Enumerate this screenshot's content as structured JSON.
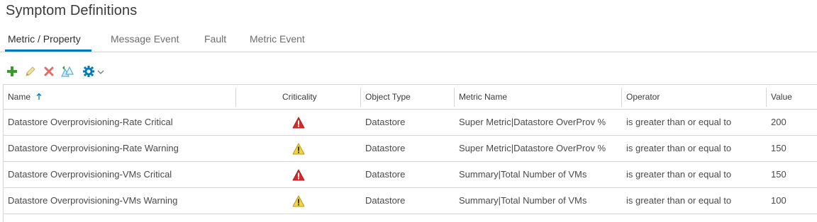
{
  "page": {
    "title": "Symptom Definitions"
  },
  "tabs": [
    {
      "label": "Metric / Property",
      "active": true
    },
    {
      "label": "Message Event",
      "active": false
    },
    {
      "label": "Fault",
      "active": false
    },
    {
      "label": "Metric Event",
      "active": false
    }
  ],
  "toolbar": {
    "buttons": [
      {
        "name": "add",
        "icon": "plus-icon",
        "color": "#3c9a2c"
      },
      {
        "name": "edit",
        "icon": "pencil-icon",
        "color": "#d8c27a"
      },
      {
        "name": "delete",
        "icon": "x-icon",
        "color": "#e26b6b"
      },
      {
        "name": "clone",
        "icon": "clone-icon",
        "color": "#5fb0d8"
      },
      {
        "name": "settings",
        "icon": "gear-icon",
        "color": "#0079b8"
      }
    ]
  },
  "grid": {
    "columns": [
      {
        "label": "Name",
        "sorted": "ascending"
      },
      {
        "label": "Criticality"
      },
      {
        "label": "Object Type"
      },
      {
        "label": "Metric Name"
      },
      {
        "label": "Operator"
      },
      {
        "label": "Value"
      }
    ],
    "rows": [
      {
        "name": "Datastore Overprovisioning-Rate Critical",
        "criticality": "critical",
        "object_type": "Datastore",
        "metric_name": "Super Metric|Datastore OverProv %",
        "operator": "is greater than or equal to",
        "value": "200"
      },
      {
        "name": "Datastore Overprovisioning-Rate Warning",
        "criticality": "warning",
        "object_type": "Datastore",
        "metric_name": "Super Metric|Datastore OverProv %",
        "operator": "is greater than or equal to",
        "value": "150"
      },
      {
        "name": "Datastore Overprovisioning-VMs Critical",
        "criticality": "critical",
        "object_type": "Datastore",
        "metric_name": "Summary|Total Number of VMs",
        "operator": "is greater than or equal to",
        "value": "150"
      },
      {
        "name": "Datastore Overprovisioning-VMs Warning",
        "criticality": "warning",
        "object_type": "Datastore",
        "metric_name": "Summary|Total Number of VMs",
        "operator": "is greater than or equal to",
        "value": "100"
      }
    ]
  },
  "colors": {
    "accent": "#0079b8",
    "critical": "#d72b2b",
    "warning": "#f5d33d",
    "border": "#d4d4d4"
  }
}
